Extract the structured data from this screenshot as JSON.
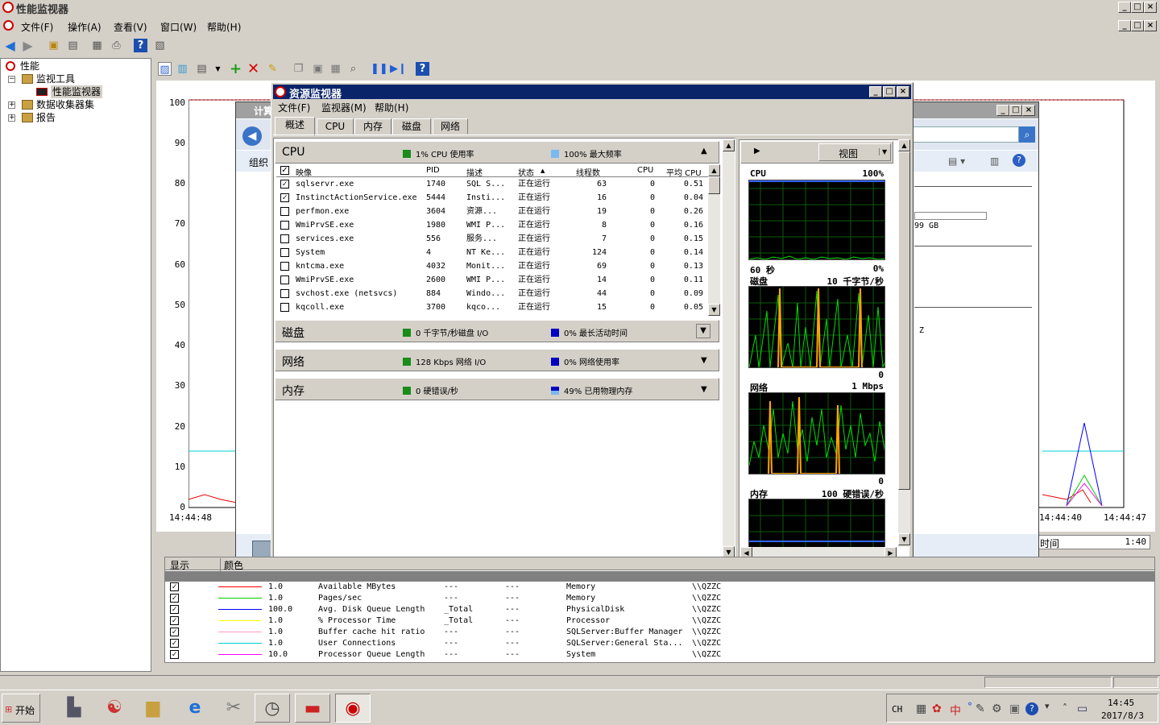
{
  "window": {
    "title": "性能监视器"
  },
  "menu": [
    {
      "label": "文件(F)"
    },
    {
      "label": "操作(A)"
    },
    {
      "label": "查看(V)"
    },
    {
      "label": "窗口(W)"
    },
    {
      "label": "帮助(H)"
    }
  ],
  "tree": {
    "root": "性能",
    "monitor_tools": "监视工具",
    "perf_monitor": "性能监视器",
    "data_collector_sets": "数据收集器集",
    "reports": "报告"
  },
  "graph": {
    "yticks": [
      "100",
      "90",
      "80",
      "70",
      "60",
      "50",
      "40",
      "30",
      "20",
      "10",
      "0"
    ],
    "x_start": "14:44:48",
    "x_mid": "14:44:40",
    "x_end": "14:44:47",
    "duration_label": "时间",
    "duration_value": "1:40"
  },
  "background_window": {
    "title_fragment": "计算",
    "org_label": "组织",
    "size_fragment": "99 GB",
    "z_fragment": "Z"
  },
  "counters": {
    "headers": {
      "show": "显示",
      "color": "颜色"
    },
    "rows": [
      {
        "scale": "1.0",
        "counter": "Available MBytes",
        "instance": "---",
        "parent": "---",
        "object": "Memory",
        "computer": "\\\\QZZC",
        "color": "#ff0000"
      },
      {
        "scale": "1.0",
        "counter": "Pages/sec",
        "instance": "---",
        "parent": "---",
        "object": "Memory",
        "computer": "\\\\QZZC",
        "color": "#00cc00"
      },
      {
        "scale": "100.0",
        "counter": "Avg. Disk Queue Length",
        "instance": "_Total",
        "parent": "---",
        "object": "PhysicalDisk",
        "computer": "\\\\QZZC",
        "color": "#0000ff"
      },
      {
        "scale": "1.0",
        "counter": "% Processor Time",
        "instance": "_Total",
        "parent": "---",
        "object": "Processor",
        "computer": "\\\\QZZC",
        "color": "#ffff00"
      },
      {
        "scale": "1.0",
        "counter": "Buffer cache hit ratio",
        "instance": "---",
        "parent": "---",
        "object": "SQLServer:Buffer Manager",
        "computer": "\\\\QZZC",
        "color": "#ff99cc"
      },
      {
        "scale": "1.0",
        "counter": "User Connections",
        "instance": "---",
        "parent": "---",
        "object": "SQLServer:General Sta...",
        "computer": "\\\\QZZC",
        "color": "#00cccc"
      },
      {
        "scale": "10.0",
        "counter": "Processor Queue Length",
        "instance": "---",
        "parent": "---",
        "object": "System",
        "computer": "\\\\QZZC",
        "color": "#ff00ff"
      }
    ]
  },
  "resmon": {
    "title": "资源监视器",
    "menu": [
      "文件(F)",
      "监视器(M)",
      "帮助(H)"
    ],
    "tabs": [
      "概述",
      "CPU",
      "内存",
      "磁盘",
      "网络"
    ],
    "cpu": {
      "name": "CPU",
      "stat1": "1% CPU 使用率",
      "stat2": "100% 最大频率",
      "columns": [
        "映像",
        "PID",
        "描述",
        "状态",
        "线程数",
        "CPU",
        "平均 CPU"
      ],
      "processes": [
        {
          "checked": true,
          "image": "sqlservr.exe",
          "pid": "1740",
          "desc": "SQL S...",
          "status": "正在运行",
          "threads": "63",
          "cpu": "0",
          "avg": "0.51"
        },
        {
          "checked": true,
          "image": "InstinctActionService.exe",
          "pid": "5444",
          "desc": "Insti...",
          "status": "正在运行",
          "threads": "16",
          "cpu": "0",
          "avg": "0.04"
        },
        {
          "checked": false,
          "image": "perfmon.exe",
          "pid": "3604",
          "desc": "资源...",
          "status": "正在运行",
          "threads": "19",
          "cpu": "0",
          "avg": "0.26"
        },
        {
          "checked": false,
          "image": "WmiPrvSE.exe",
          "pid": "1980",
          "desc": "WMI P...",
          "status": "正在运行",
          "threads": "8",
          "cpu": "0",
          "avg": "0.16"
        },
        {
          "checked": false,
          "image": "services.exe",
          "pid": "556",
          "desc": "服务...",
          "status": "正在运行",
          "threads": "7",
          "cpu": "0",
          "avg": "0.15"
        },
        {
          "checked": false,
          "image": "System",
          "pid": "4",
          "desc": "NT Ke...",
          "status": "正在运行",
          "threads": "124",
          "cpu": "0",
          "avg": "0.14"
        },
        {
          "checked": false,
          "image": "kntcma.exe",
          "pid": "4032",
          "desc": "Monit...",
          "status": "正在运行",
          "threads": "69",
          "cpu": "0",
          "avg": "0.13"
        },
        {
          "checked": false,
          "image": "WmiPrvSE.exe",
          "pid": "2600",
          "desc": "WMI P...",
          "status": "正在运行",
          "threads": "14",
          "cpu": "0",
          "avg": "0.11"
        },
        {
          "checked": false,
          "image": "svchost.exe (netsvcs)",
          "pid": "884",
          "desc": "Windo...",
          "status": "正在运行",
          "threads": "44",
          "cpu": "0",
          "avg": "0.09"
        },
        {
          "checked": false,
          "image": "kqcoll.exe",
          "pid": "3700",
          "desc": "kqco...",
          "status": "正在运行",
          "threads": "15",
          "cpu": "0",
          "avg": "0.05"
        }
      ]
    },
    "disk": {
      "name": "磁盘",
      "stat1": "0 千字节/秒磁盘 I/O",
      "stat2": "0% 最长活动时间"
    },
    "network": {
      "name": "网络",
      "stat1": "128 Kbps 网络 I/O",
      "stat2": "0% 网络使用率"
    },
    "memory": {
      "name": "内存",
      "stat1": "0 硬错误/秒",
      "stat2": "49% 已用物理内存"
    },
    "view_button": "视图",
    "graphs": {
      "cpu_title": "CPU",
      "cpu_max": "100%",
      "cpu_time": "60 秒",
      "cpu_min": "0%",
      "disk_title": "磁盘",
      "disk_max": "10 千字节/秒",
      "disk_min": "0",
      "net_title": "网络",
      "net_max": "1 Mbps",
      "net_min": "0",
      "mem_title": "内存",
      "mem_max": "100 硬错误/秒"
    }
  },
  "taskbar": {
    "start": "开始",
    "lang": "CH",
    "ime": "中",
    "time": "14:45",
    "date": "2017/8/3"
  },
  "colors": {
    "titlebar": "#0a246a",
    "cpu_green": "#00c000",
    "disk_orange": "#ffa500",
    "mem_blue": "#3366ff"
  }
}
